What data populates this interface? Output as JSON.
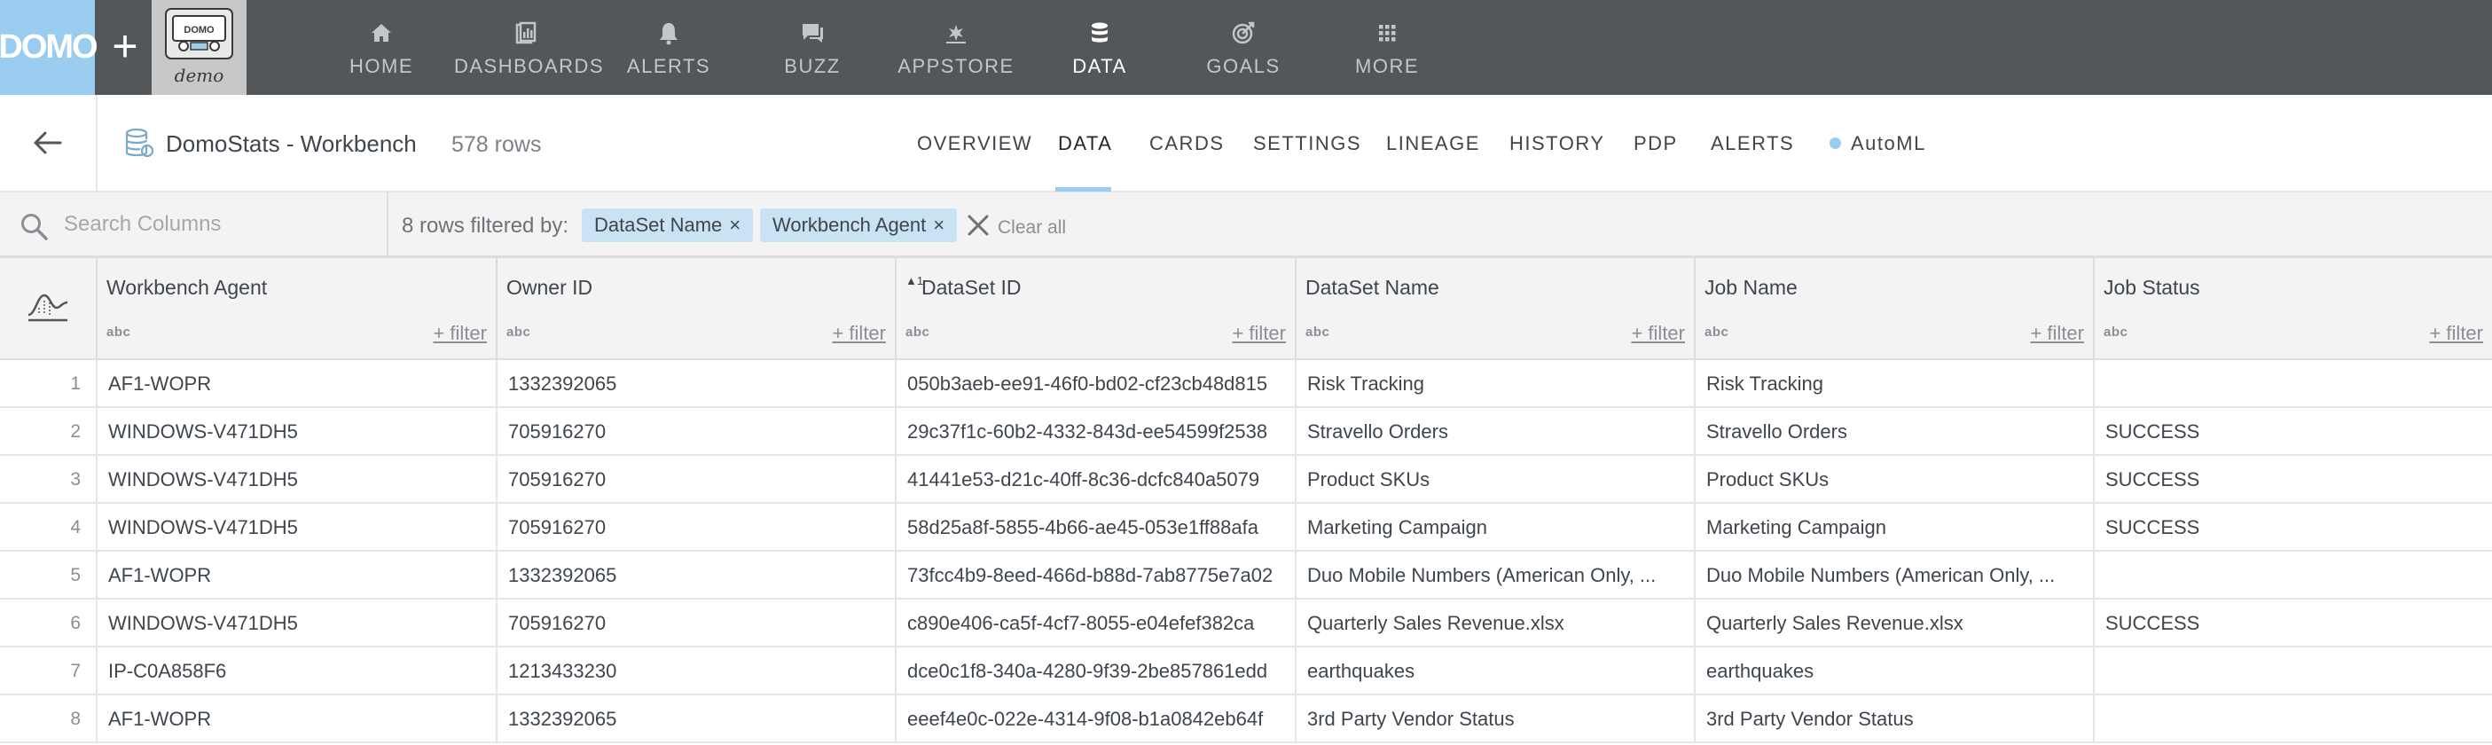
{
  "nav": {
    "logo": "DOMO",
    "plus": "+",
    "instance_logo_text": "DOMO",
    "instance_logo_sub": "demo",
    "items": [
      {
        "label": "HOME",
        "icon": "home-icon"
      },
      {
        "label": "DASHBOARDS",
        "icon": "dashboards-icon"
      },
      {
        "label": "ALERTS",
        "icon": "bell-icon"
      },
      {
        "label": "BUZZ",
        "icon": "chat-icon"
      },
      {
        "label": "APPSTORE",
        "icon": "appstore-icon"
      },
      {
        "label": "DATA",
        "icon": "database-icon"
      },
      {
        "label": "GOALS",
        "icon": "goals-icon"
      },
      {
        "label": "MORE",
        "icon": "grid-icon"
      }
    ],
    "active": "DATA"
  },
  "dataset": {
    "title": "DomoStats - Workbench",
    "rows_label": "578 rows",
    "tabs": [
      "OVERVIEW",
      "DATA",
      "CARDS",
      "SETTINGS",
      "LINEAGE",
      "HISTORY",
      "PDP",
      "ALERTS",
      "AutoML"
    ],
    "active_tab": "DATA"
  },
  "filterbar": {
    "search_placeholder": "Search Columns",
    "summary": "8 rows filtered by:",
    "chips": [
      "DataSet Name",
      "Workbench Agent"
    ],
    "chip_close": "×",
    "clear_all": "Clear all"
  },
  "table": {
    "add_filter_label": "+ filter",
    "type_label": "abc",
    "sort_indicator": "▲1",
    "columns": [
      "Workbench Agent",
      "Owner ID",
      "DataSet ID",
      "DataSet Name",
      "Job Name",
      "Job Status"
    ],
    "rows": [
      {
        "idx": "1",
        "cells": [
          "AF1-WOPR",
          "1332392065",
          "050b3aeb-ee91-46f0-bd02-cf23cb48d815",
          "Risk Tracking",
          "Risk Tracking",
          ""
        ]
      },
      {
        "idx": "2",
        "cells": [
          "WINDOWS-V471DH5",
          "705916270",
          "29c37f1c-60b2-4332-843d-ee54599f2538",
          "Stravello Orders",
          "Stravello Orders",
          "SUCCESS"
        ]
      },
      {
        "idx": "3",
        "cells": [
          "WINDOWS-V471DH5",
          "705916270",
          "41441e53-d21c-40ff-8c36-dcfc840a5079",
          "Product SKUs",
          "Product SKUs",
          "SUCCESS"
        ]
      },
      {
        "idx": "4",
        "cells": [
          "WINDOWS-V471DH5",
          "705916270",
          "58d25a8f-5855-4b66-ae45-053e1ff88afa",
          "Marketing Campaign",
          "Marketing Campaign",
          "SUCCESS"
        ]
      },
      {
        "idx": "5",
        "cells": [
          "AF1-WOPR",
          "1332392065",
          "73fcc4b9-8eed-466d-b88d-7ab8775e7a02",
          "Duo Mobile Numbers (American Only, ...",
          "Duo Mobile Numbers (American Only, ...",
          ""
        ]
      },
      {
        "idx": "6",
        "cells": [
          "WINDOWS-V471DH5",
          "705916270",
          "c890e406-ca5f-4cf7-8055-e04efef382ca",
          "Quarterly Sales Revenue.xlsx",
          "Quarterly Sales Revenue.xlsx",
          "SUCCESS"
        ]
      },
      {
        "idx": "7",
        "cells": [
          "IP-C0A858F6",
          "1213433230",
          "dce0c1f8-340a-4280-9f39-2be857861edd",
          "earthquakes",
          "earthquakes",
          ""
        ]
      },
      {
        "idx": "8",
        "cells": [
          "AF1-WOPR",
          "1332392065",
          "eeef4e0c-022e-4314-9f08-b1a0842eb64f",
          "3rd Party Vendor Status",
          "3rd Party Vendor Status",
          ""
        ]
      }
    ]
  }
}
